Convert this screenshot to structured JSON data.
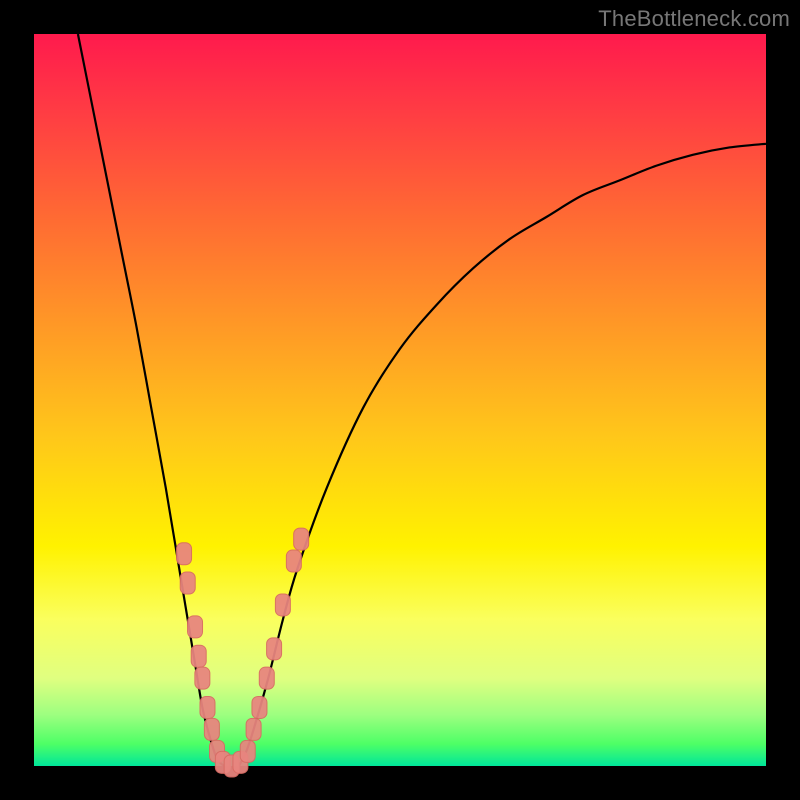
{
  "watermark": "TheBottleneck.com",
  "colors": {
    "frame": "#000000",
    "curve": "#000000",
    "marker_fill": "#e8857f",
    "marker_stroke": "#d86b63"
  },
  "chart_data": {
    "type": "line",
    "title": "",
    "xlabel": "",
    "ylabel": "",
    "xlim": [
      0,
      100
    ],
    "ylim": [
      0,
      100
    ],
    "grid": false,
    "legend": false,
    "note": "V-shaped bottleneck curve; values are read off the rendered curve (y = percent of plot height from bottom).",
    "series": [
      {
        "name": "left-branch",
        "x": [
          6,
          8,
          10,
          12,
          14,
          16,
          18,
          20,
          22,
          23,
          24,
          25,
          26
        ],
        "y": [
          100,
          90,
          80,
          70,
          60,
          49,
          38,
          26,
          14,
          8,
          4,
          1,
          0
        ]
      },
      {
        "name": "right-branch",
        "x": [
          28,
          29,
          30,
          32,
          34,
          36,
          40,
          45,
          50,
          55,
          60,
          65,
          70,
          75,
          80,
          85,
          90,
          95,
          100
        ],
        "y": [
          0,
          2,
          5,
          12,
          20,
          27,
          38,
          49,
          57,
          63,
          68,
          72,
          75,
          78,
          80,
          82,
          83.5,
          84.5,
          85
        ]
      }
    ],
    "markers": {
      "name": "highlighted-points",
      "shape": "rounded-rect",
      "points": [
        {
          "x": 20.5,
          "y": 29
        },
        {
          "x": 21.0,
          "y": 25
        },
        {
          "x": 22.0,
          "y": 19
        },
        {
          "x": 22.5,
          "y": 15
        },
        {
          "x": 23.0,
          "y": 12
        },
        {
          "x": 23.7,
          "y": 8
        },
        {
          "x": 24.3,
          "y": 5
        },
        {
          "x": 25.0,
          "y": 2
        },
        {
          "x": 25.8,
          "y": 0.5
        },
        {
          "x": 27.0,
          "y": 0
        },
        {
          "x": 28.2,
          "y": 0.5
        },
        {
          "x": 29.2,
          "y": 2
        },
        {
          "x": 30.0,
          "y": 5
        },
        {
          "x": 30.8,
          "y": 8
        },
        {
          "x": 31.8,
          "y": 12
        },
        {
          "x": 32.8,
          "y": 16
        },
        {
          "x": 34.0,
          "y": 22
        },
        {
          "x": 35.5,
          "y": 28
        },
        {
          "x": 36.5,
          "y": 31
        }
      ]
    }
  }
}
